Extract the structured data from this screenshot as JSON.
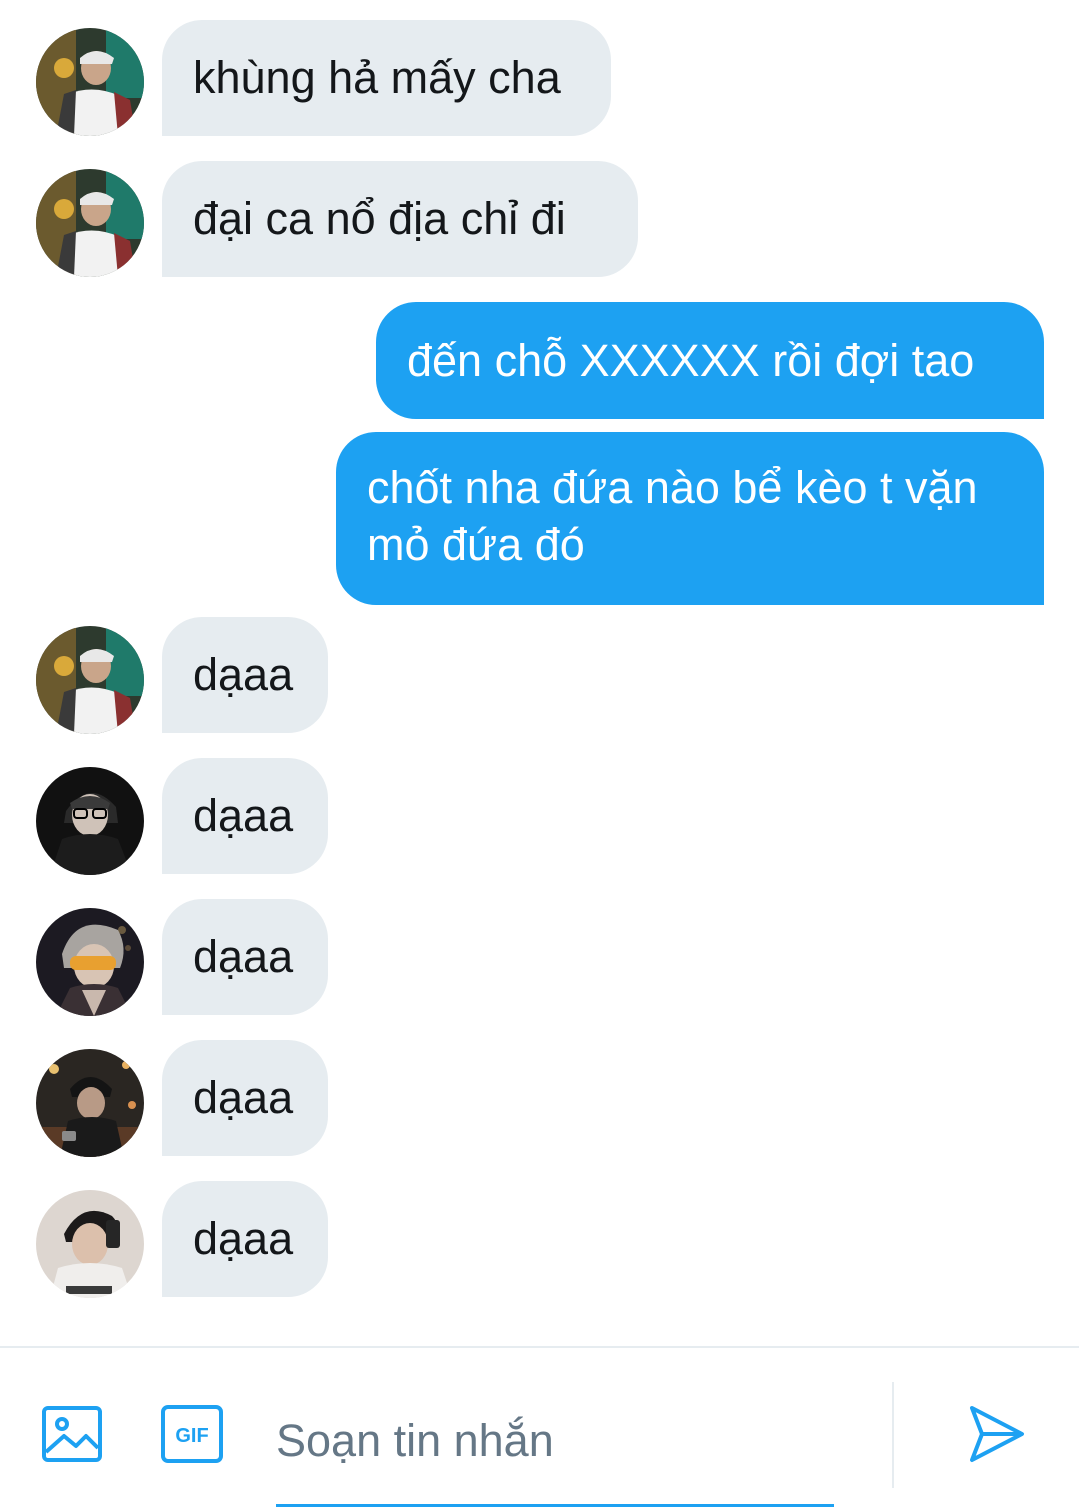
{
  "messages": [
    {
      "direction": "in",
      "text": "khùng hả mấy cha",
      "avatar": "avatar-user-1"
    },
    {
      "direction": "in",
      "text": "đại ca nổ địa chỉ đi",
      "avatar": "avatar-user-1"
    },
    {
      "direction": "out",
      "text": "đến chỗ XXXXXX rồi đợi tao"
    },
    {
      "direction": "out",
      "line1": "chốt nha đứa nào bể kèo t vặn",
      "line2": "mỏ đứa đó"
    },
    {
      "direction": "in",
      "text": "dạaa",
      "avatar": "avatar-user-1"
    },
    {
      "direction": "in",
      "text": "dạaa",
      "avatar": "avatar-user-2"
    },
    {
      "direction": "in",
      "text": "dạaa",
      "avatar": "avatar-user-3"
    },
    {
      "direction": "in",
      "text": "dạaa",
      "avatar": "avatar-user-4"
    },
    {
      "direction": "in",
      "text": "dạaa",
      "avatar": "avatar-user-5"
    }
  ],
  "composer": {
    "placeholder": "Soạn tin nhắn",
    "value": "",
    "gif_label": "GIF",
    "image_icon": "image-icon",
    "gif_icon": "gif-icon",
    "send_icon": "send-icon"
  },
  "colors": {
    "accent": "#1da1f2",
    "incoming_bubble": "#e6ecf0",
    "incoming_text": "#14171a",
    "outgoing_text": "#ffffff",
    "placeholder": "#657786"
  }
}
